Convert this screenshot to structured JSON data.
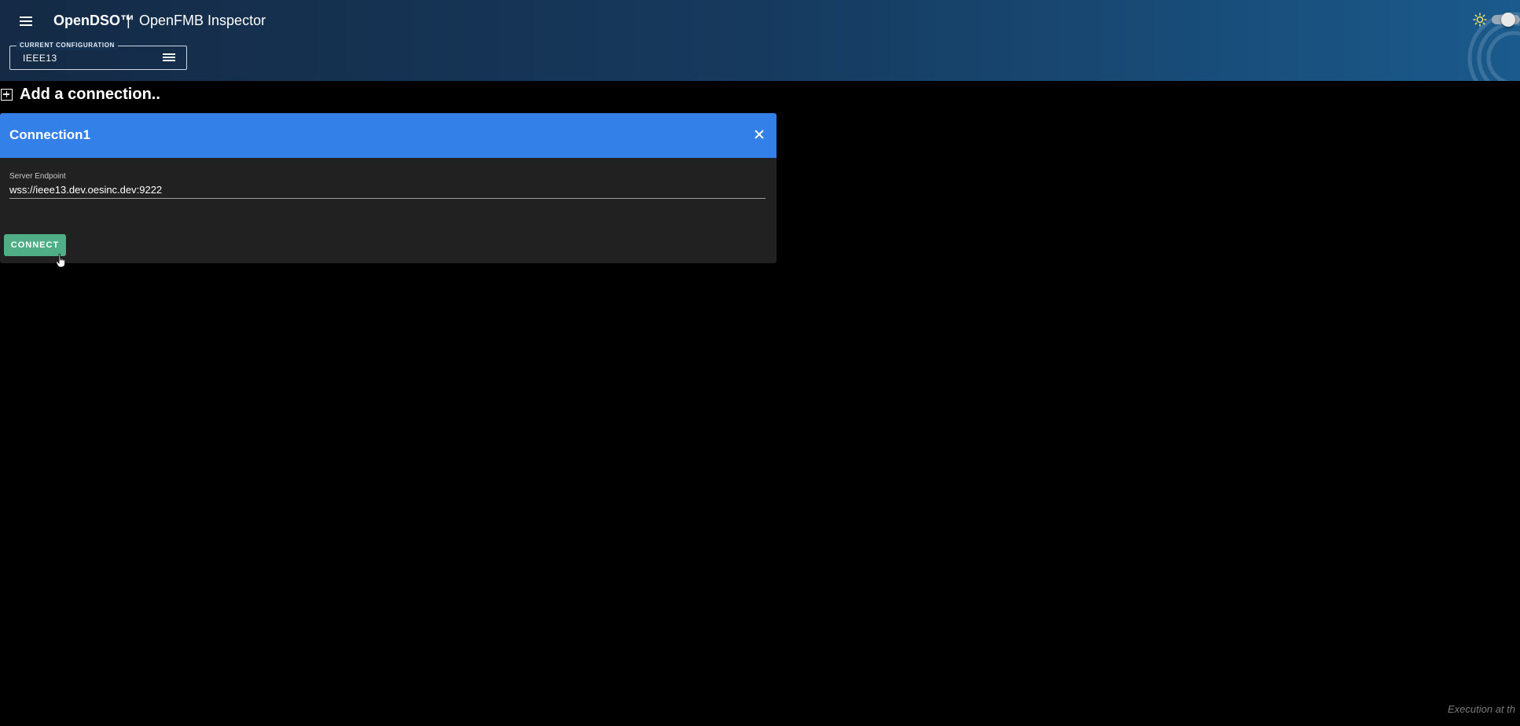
{
  "header": {
    "brand": "OpenDSO™",
    "separator": "|",
    "app_title": "OpenFMB Inspector",
    "menu_icon": "hamburger-menu-icon",
    "theme_icon": "sun-icon"
  },
  "config": {
    "legend": "CURRENT CONFIGURATION",
    "value": "IEEE13",
    "menu_icon": "hamburger-menu-icon"
  },
  "add_connection": {
    "label": "Add a connection..",
    "icon": "plus-square-icon"
  },
  "connection": {
    "title": "Connection1",
    "close_icon": "close-icon",
    "endpoint_label": "Server Endpoint",
    "endpoint_value": "wss://ieee13.dev.oesinc.dev:9222",
    "connect_label": "CONNECT"
  },
  "footer": {
    "status_text": "Execution at th"
  },
  "colors": {
    "card_header": "#3280e8",
    "connect_button": "#4fae85",
    "card_body": "#212121",
    "sun_icon": "#f5e56b"
  }
}
